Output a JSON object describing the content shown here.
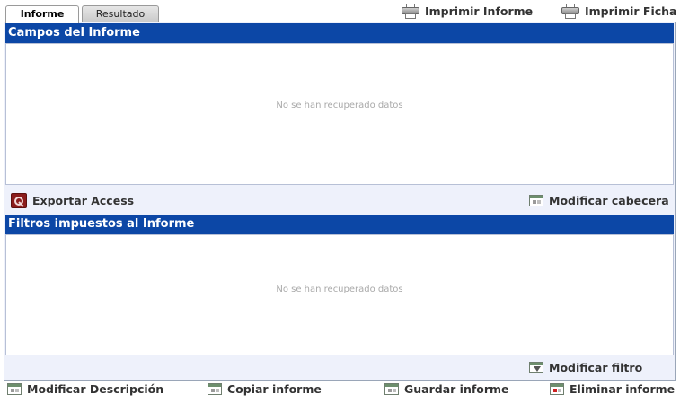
{
  "tabs": [
    {
      "label": "Informe",
      "active": true
    },
    {
      "label": "Resultado",
      "active": false
    }
  ],
  "top_actions": {
    "print_report": "Imprimir Informe",
    "print_sheet": "Imprimir Ficha"
  },
  "fields_section": {
    "title": "Campos del Informe",
    "empty_message": "No se han recuperado datos",
    "export_label": "Exportar Access",
    "modify_header_label": "Modificar cabecera"
  },
  "filters_section": {
    "title": "Filtros impuestos al Informe",
    "empty_message": "No se han recuperado datos",
    "modify_filter_label": "Modificar filtro"
  },
  "bottom_actions": {
    "modify_description": "Modificar Descripción",
    "copy_report": "Copiar informe",
    "save_report": "Guardar informe",
    "delete_report": "Eliminar informe"
  },
  "colors": {
    "header_bg": "#0c47a6",
    "frame_bg": "#eef1fb",
    "empty_text": "#a9a9a9"
  }
}
